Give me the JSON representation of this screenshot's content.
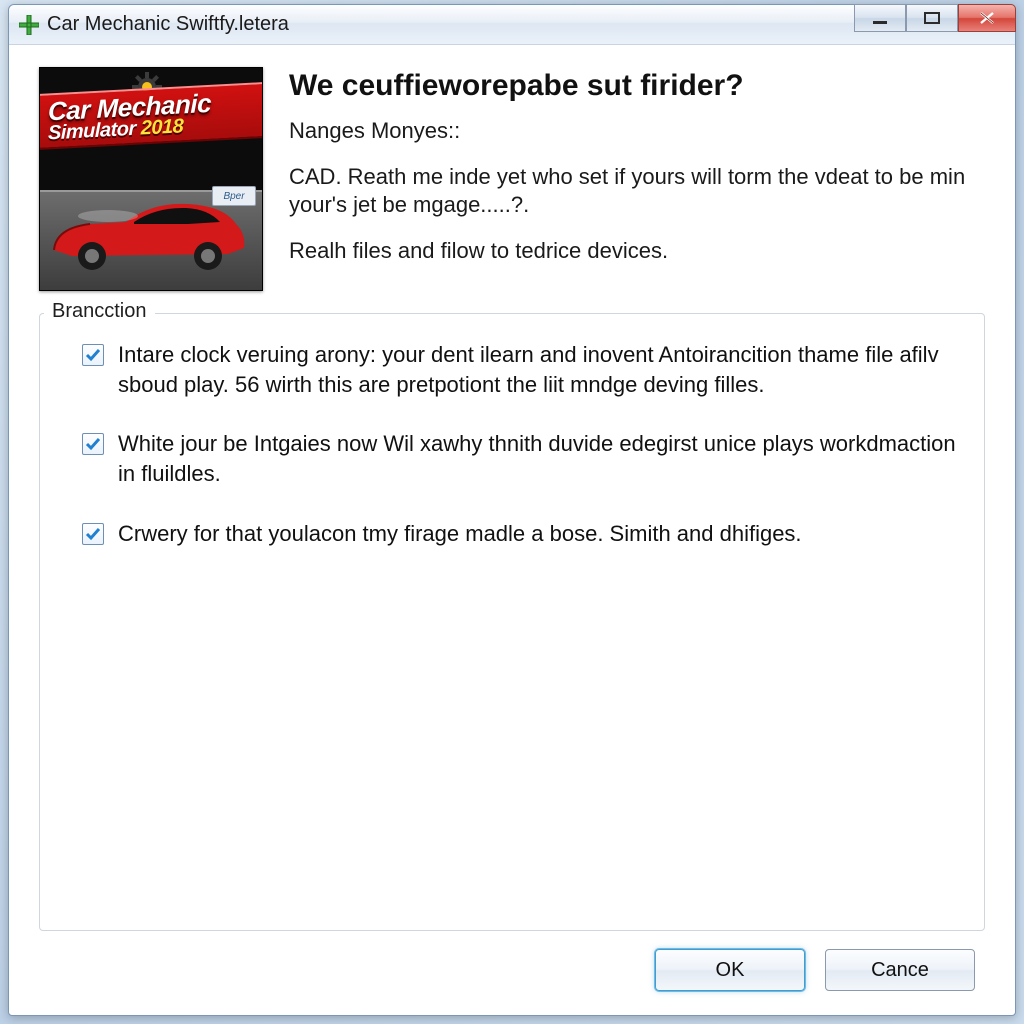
{
  "window": {
    "title": "Car Mechanic Swiftfy.letera"
  },
  "logo": {
    "line1": "Car Mechanic",
    "line2_prefix": "Simulator ",
    "line2_year": "2018",
    "small_badge": "Bper"
  },
  "intro": {
    "headline": "We ceuffieworepabe sut firider?",
    "subhead": "Nanges Monyes::",
    "para1": "CAD. Reath me inde yet who set if yours will torm the vdeat to be min your's jet be mgage.....?.",
    "para2": "Realh files and filow to tedrice devices."
  },
  "group": {
    "legend": "Brancction",
    "options": [
      "Intare clock veruing arony: your dent ilearn and inovent Antoirancition thame file afilv sboud play. 56 wirth this are pretpotiont the liit mndge deving filles.",
      "White jour be Intgaies now Wil xawhy thnith duvide edegirst unice plays workdmaction in fluildles.",
      "Crwery for that youlacon tmy firage madle a bose. Simith and dhifiges."
    ]
  },
  "buttons": {
    "ok": "OK",
    "cancel": "Cance"
  },
  "colors": {
    "accent": "#2b90d9",
    "check": "#1f7fd1"
  }
}
